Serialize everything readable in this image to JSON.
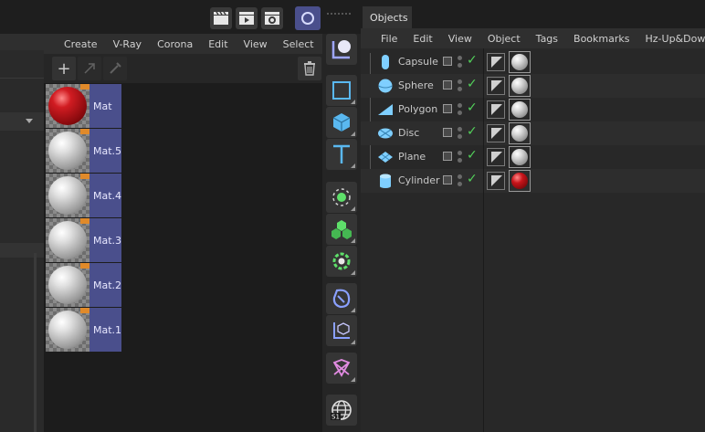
{
  "top_toolbar": {
    "buttons": [
      {
        "icon": "clapperboard-icon"
      },
      {
        "icon": "clapperboard-play-icon"
      },
      {
        "icon": "clapperboard-gear-icon"
      }
    ],
    "object_toggle_icon": "circle-ring-icon"
  },
  "material_manager": {
    "menu": [
      "Create",
      "V-Ray",
      "Corona",
      "Edit",
      "View",
      "Select",
      ">"
    ],
    "toolbar": {
      "add_label": "+"
    },
    "materials": [
      {
        "name": "Mat",
        "color": "red"
      },
      {
        "name": "Mat.5",
        "color": "grey"
      },
      {
        "name": "Mat.4",
        "color": "grey"
      },
      {
        "name": "Mat.3",
        "color": "grey"
      },
      {
        "name": "Mat.2",
        "color": "grey"
      },
      {
        "name": "Mat.1",
        "color": "grey"
      }
    ]
  },
  "palette": {
    "buttons": [
      "coordinate-system-icon",
      "rectangle-spline-icon",
      "cube-icon",
      "text-spline-icon",
      "point-snap-icon",
      "cloner-icon",
      "generator-icon",
      "deformer-icon",
      "axis-icon",
      "field-icon",
      "globe-icon"
    ]
  },
  "object_manager": {
    "tab_label": "Objects",
    "menu": [
      "File",
      "Edit",
      "View",
      "Object",
      "Tags",
      "Bookmarks",
      "Hz-Up&Down"
    ],
    "objects": [
      {
        "name": "Capsule",
        "icon": "capsule-icon",
        "material": "grey"
      },
      {
        "name": "Sphere",
        "icon": "sphere-icon",
        "material": "grey"
      },
      {
        "name": "Polygon",
        "icon": "polygon-icon",
        "material": "grey"
      },
      {
        "name": "Disc",
        "icon": "disc-icon",
        "material": "grey"
      },
      {
        "name": "Plane",
        "icon": "plane-icon",
        "material": "grey"
      },
      {
        "name": "Cylinder",
        "icon": "cylinder-icon",
        "material": "red"
      }
    ]
  },
  "colors": {
    "accent": "#4a4f8c",
    "check": "#52d05a",
    "object_icon": "#7fcfff",
    "mat_red": "#b3161b",
    "mat_grey": "#d8d8d8"
  }
}
